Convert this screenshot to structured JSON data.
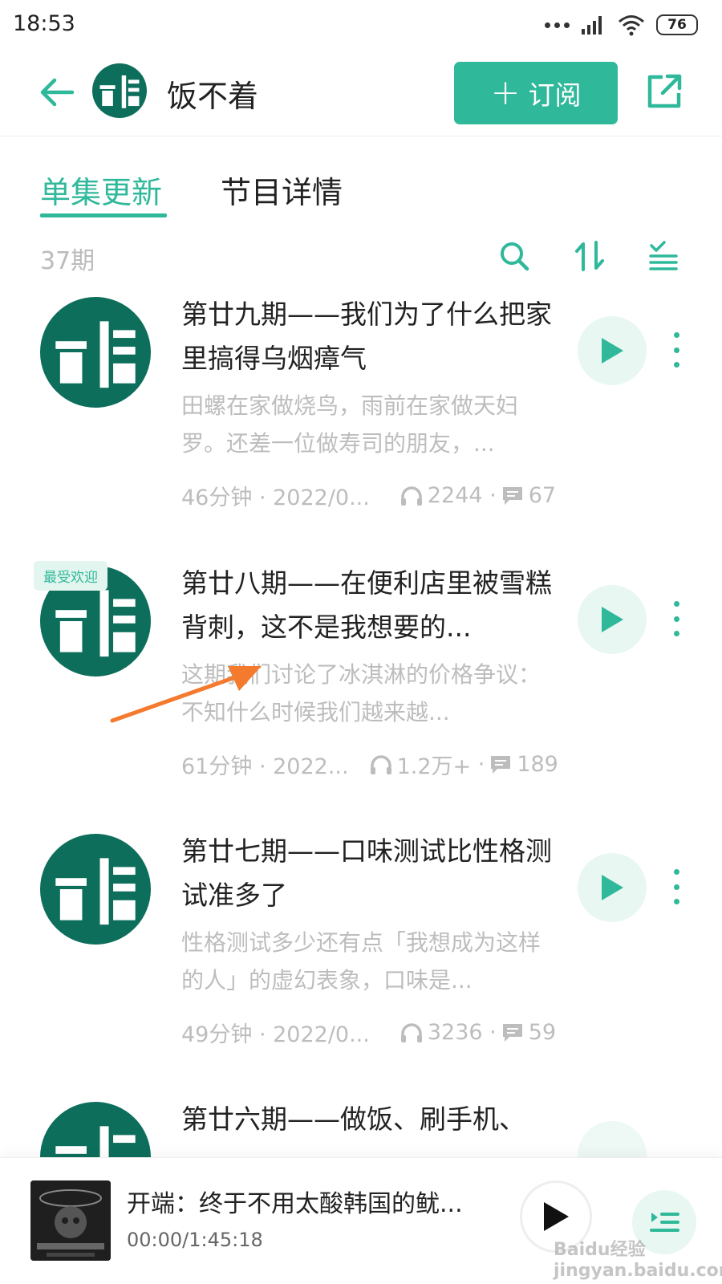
{
  "status_bar": {
    "time": "18:53",
    "battery": "76"
  },
  "header": {
    "title": "饭不着",
    "subscribe_label": "订阅"
  },
  "tabs": [
    {
      "label": "单集更新"
    },
    {
      "label": "节目详情"
    }
  ],
  "episode_count": "37期",
  "episodes": [
    {
      "title": "第廿九期——我们为了什么把家里搞得乌烟瘴气",
      "description": "田螺在家做烧鸟，雨前在家做天妇罗。还差一位做寿司的朋友，...",
      "duration_date": "46分钟 · 2022/0...",
      "plays": "2244",
      "comments": "67"
    },
    {
      "badge": "最受欢迎",
      "title": "第廿八期——在便利店里被雪糕背刺，这不是我想要的...",
      "description": "这期我们讨论了冰淇淋的价格争议：不知什么时候我们越来越...",
      "duration_date": "61分钟 · 2022...",
      "plays": "1.2万+",
      "comments": "189"
    },
    {
      "title": "第廿七期——口味测试比性格测试准多了",
      "description": "性格测试多少还有点「我想成为这样的人」的虚幻表象，口味是...",
      "duration_date": "49分钟 · 2022/0...",
      "plays": "3236",
      "comments": "59"
    },
    {
      "title": "第廿六期——做饭、刷手机、"
    }
  ],
  "mini_player": {
    "title": "开端：终于不用太酸韩国的鱿...",
    "time": "00:00/1:45:18",
    "watermark": "Baidu经验 jingyan.baidu.com"
  },
  "colors": {
    "accent": "#2fb89a",
    "cover": "#0d6e5c",
    "annotation_arrow": "#f47a2e"
  }
}
